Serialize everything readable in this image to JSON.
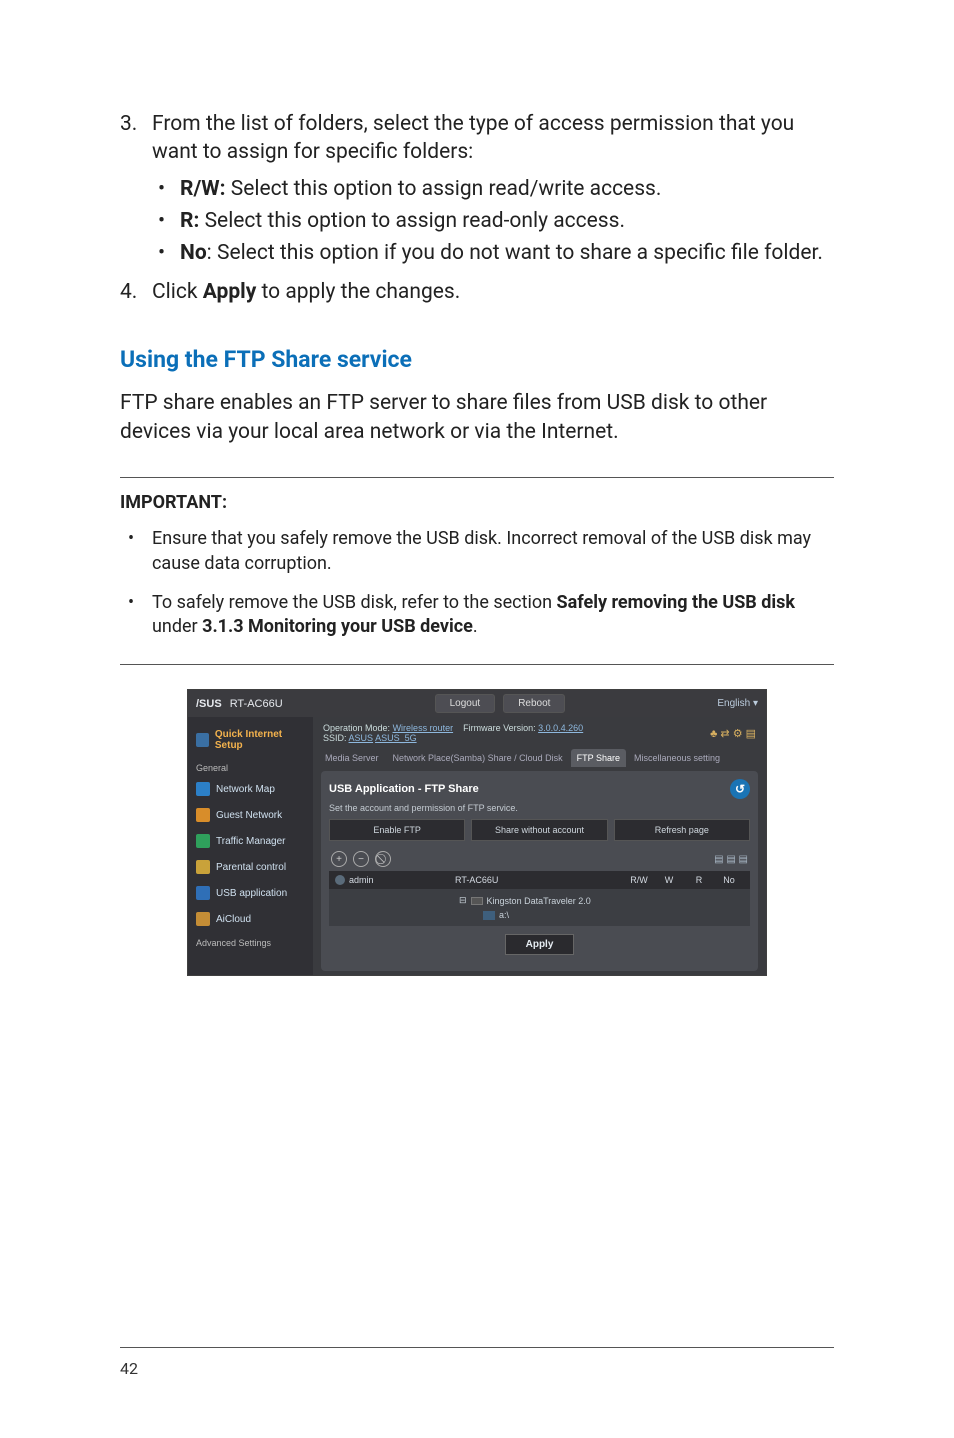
{
  "steps": {
    "step3": {
      "num": "3.",
      "text_a": "From the list of folders, select the type of access permission that you want to assign for specific folders:",
      "bullets": [
        {
          "label": "R/W:",
          "text": "  Select this option to assign read/write access."
        },
        {
          "label": "R:",
          "text": "  Select this option to assign read-only access."
        },
        {
          "label": "No",
          "suffix": ":",
          "text": "  Select this option if you do not want to share a specific file folder."
        }
      ]
    },
    "step4": {
      "num": "4.",
      "text_a": "Click ",
      "bold": "Apply",
      "text_b": " to apply the changes."
    }
  },
  "section_heading": "Using the FTP Share service",
  "body_text": "FTP share enables an FTP server to share files from USB disk to other devices via your local area network or via the Internet.",
  "important": {
    "label": "IMPORTANT",
    "colon": ":",
    "notes": [
      {
        "text": "Ensure that you safely remove the USB disk. Incorrect removal of the USB disk may cause data corruption."
      },
      {
        "text_a": "To safely remove the USB disk, refer to the section ",
        "bold_a": "Safely removing the USB disk",
        "text_b": " under ",
        "bold_b": "3.1.3 Monitoring your USB device",
        "text_c": "."
      }
    ]
  },
  "screenshot": {
    "logo": "/SUS",
    "model": "RT-AC66U",
    "logout": "Logout",
    "reboot": "Reboot",
    "language": "English",
    "op_mode_label": "Operation Mode:",
    "op_mode_value": "Wireless router",
    "fw_label": "Firmware Version:",
    "fw_value": "3.0.0.4.260",
    "ssid_label": "SSID:",
    "ssid_a": "ASUS",
    "ssid_b": "ASUS_5G",
    "subtabs": [
      "Media Server",
      "Network Place(Samba) Share / Cloud Disk",
      "FTP Share",
      "Miscellaneous setting"
    ],
    "panel_title": "USB Application - FTP Share",
    "panel_sub": "Set the account and permission of FTP service.",
    "btn_enable": "Enable FTP",
    "btn_share": "Share without account",
    "btn_refresh": "Refresh page",
    "user": "admin",
    "device": "RT-AC66U",
    "perms": [
      "R/W",
      "W",
      "R",
      "No"
    ],
    "tree_device": "Kingston DataTraveler 2.0",
    "tree_folder": "a:\\",
    "apply": "Apply",
    "sidebar": {
      "quick": "Quick Internet Setup",
      "general": "General",
      "items": [
        "Network Map",
        "Guest Network",
        "Traffic Manager",
        "Parental control",
        "USB application",
        "AiCloud"
      ],
      "advanced": "Advanced Settings"
    }
  },
  "page_number": "42"
}
